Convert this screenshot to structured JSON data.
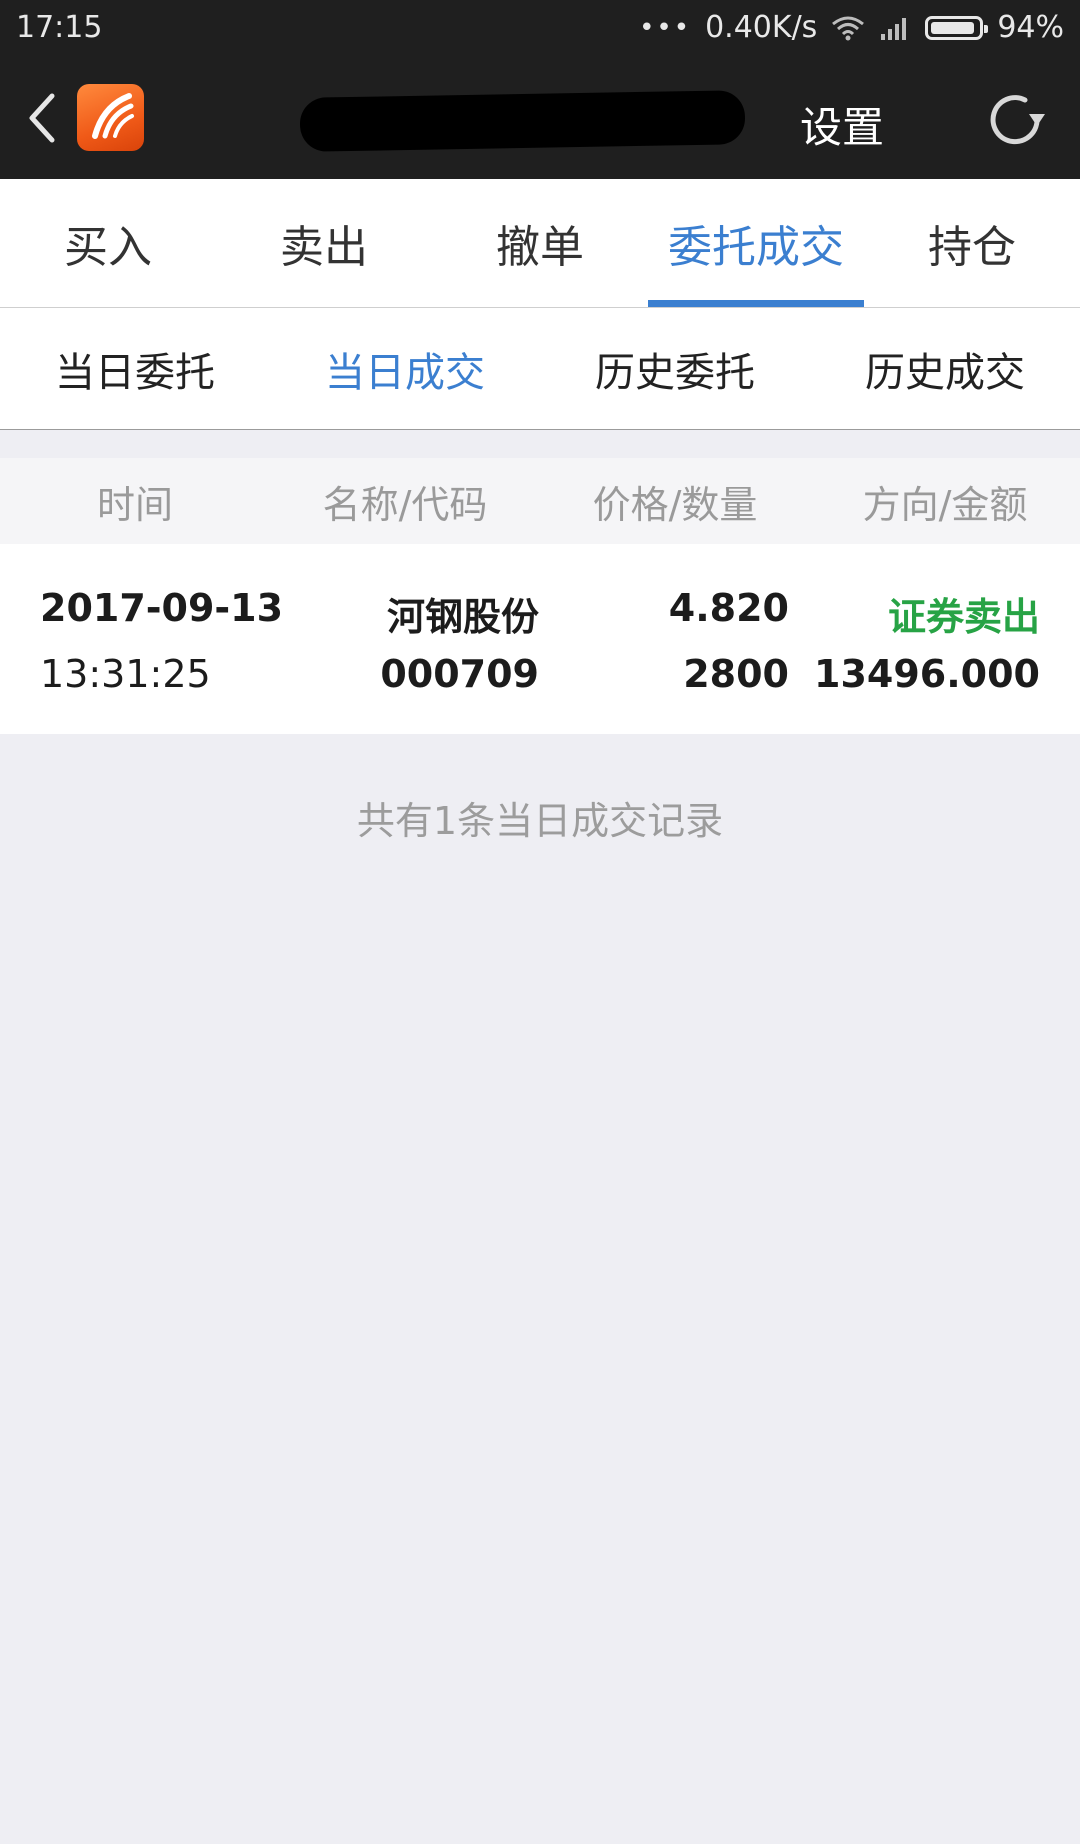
{
  "status_bar": {
    "time": "17:15",
    "network_speed": "0.40K/s",
    "battery": "94%",
    "battery_level": 0.94
  },
  "header": {
    "settings_label": "设置",
    "icons": [
      "back-arrow-icon",
      "app-logo",
      "refresh-icon"
    ]
  },
  "main_tabs": [
    {
      "label": "买入",
      "active": false
    },
    {
      "label": "卖出",
      "active": false
    },
    {
      "label": "撤单",
      "active": false
    },
    {
      "label": "委托成交",
      "active": true
    },
    {
      "label": "持仓",
      "active": false
    }
  ],
  "sub_tabs": [
    {
      "label": "当日委托",
      "active": false
    },
    {
      "label": "当日成交",
      "active": true
    },
    {
      "label": "历史委托",
      "active": false
    },
    {
      "label": "历史成交",
      "active": false
    }
  ],
  "table": {
    "columns": [
      "时间",
      "名称/代码",
      "价格/数量",
      "方向/金额"
    ],
    "rows": [
      {
        "date": "2017-09-13",
        "time": "13:31:25",
        "name": "河钢股份",
        "code": "000709",
        "price": "4.820",
        "quantity": "2800",
        "direction": "证券卖出",
        "amount": "13496.000"
      }
    ]
  },
  "footer_note": "共有1条当日成交记录",
  "colors": {
    "accent": "#3b7fd0",
    "sell_green": "#27a345",
    "header_bg": "#1f1f1f",
    "page_bg": "#eeeef3"
  }
}
